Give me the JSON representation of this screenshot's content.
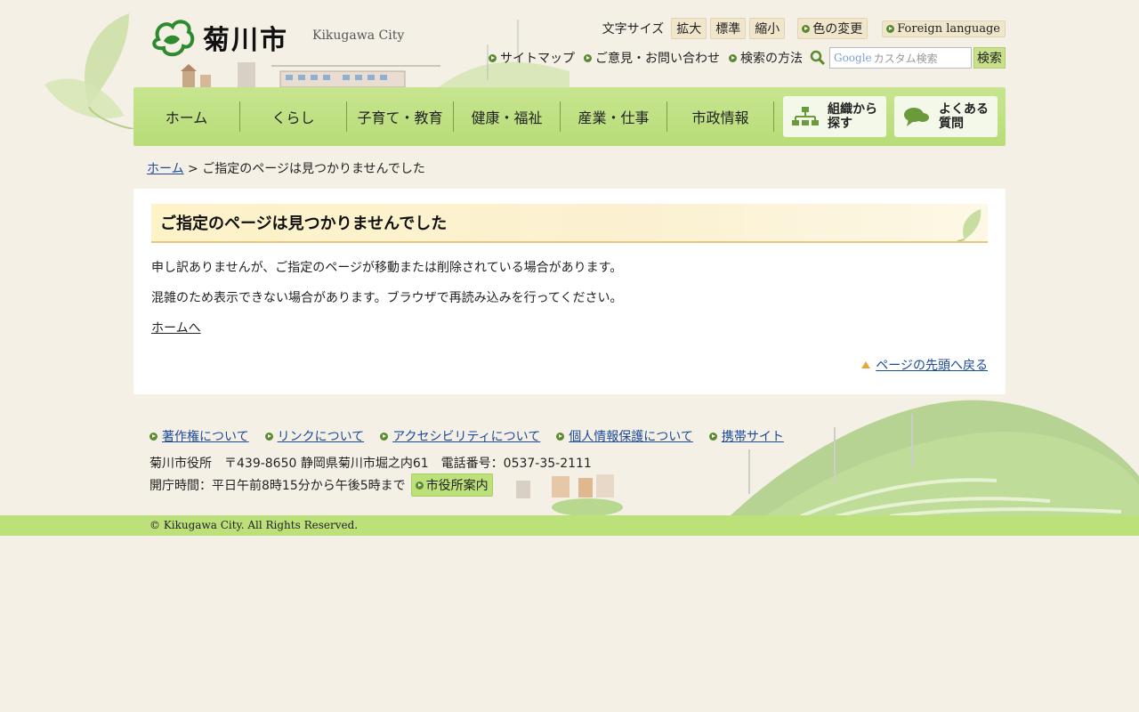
{
  "header": {
    "logo_text": "菊川市",
    "logo_en": "Kikugawa City",
    "font_size_label": "文字サイズ",
    "font_sizes": [
      "拡大",
      "標準",
      "縮小"
    ],
    "color_change": "色の変更",
    "foreign_language": "Foreign language",
    "links": [
      "サイトマップ",
      "ご意見・お問い合わせ",
      "検索の方法"
    ],
    "search_google": "Google",
    "search_placeholder": "カスタム検索",
    "search_button": "検索"
  },
  "nav": {
    "items": [
      "ホーム",
      "くらし",
      "子育て・教育",
      "健康・福祉",
      "産業・仕事",
      "市政情報"
    ],
    "org_search_1": "組織から",
    "org_search_2": "探す",
    "faq_1": "よくある",
    "faq_2": "質問"
  },
  "breadcrumb": {
    "home": "ホーム",
    "separator": " > ",
    "current": "ご指定のページは見つかりませんでした"
  },
  "content": {
    "title": "ご指定のページは見つかりませんでした",
    "para1": "申し訳ありませんが、ご指定のページが移動または削除されている場合があります。",
    "para2": "混雑のため表示できない場合があります。ブラウザで再読み込みを行ってください。",
    "home_link": "ホームへ",
    "back_to_top": "ページの先頭へ戻る"
  },
  "footer": {
    "links": [
      "著作権について",
      "リンクについて",
      "アクセシビリティについて",
      "個人情報保護について",
      "携帯サイト"
    ],
    "address": "菊川市役所　〒439-8650 静岡県菊川市堀之内61　電話番号：0537-35-2111",
    "hours": "開庁時間：平日午前8時15分から午後5時まで",
    "office_map": "市役所案内",
    "copyright": "© Kikugawa City. All Rights Reserved."
  },
  "colors": {
    "nav_green": "#c7e58f",
    "link_blue": "#1a4a99",
    "title_bg": "#fdf2c8",
    "copy_bar": "#bde17a"
  }
}
